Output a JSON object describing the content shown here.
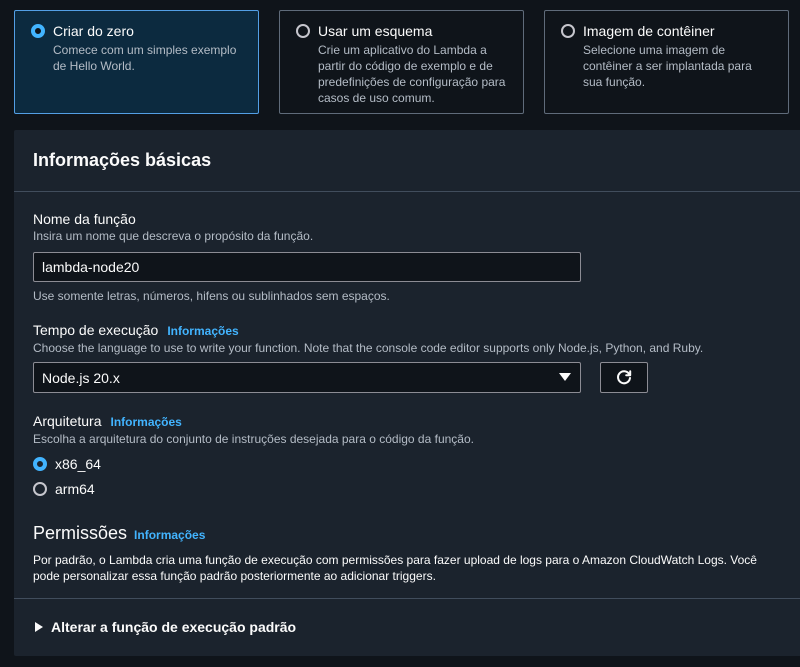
{
  "options": [
    {
      "title": "Criar do zero",
      "description": "Comece com um simples exemplo de Hello World.",
      "selected": true
    },
    {
      "title": "Usar um esquema",
      "description": "Crie um aplicativo do Lambda a partir do código de exemplo e de predefinições de configuração para casos de uso comum.",
      "selected": false
    },
    {
      "title": "Imagem de contêiner",
      "description": "Selecione uma imagem de contêiner a ser implantada para sua função.",
      "selected": false
    }
  ],
  "basic_info": {
    "title": "Informações básicas",
    "function_name": {
      "label": "Nome da função",
      "description": "Insira um nome que descreva o propósito da função.",
      "value": "lambda-node20",
      "constraint": "Use somente letras, números, hifens ou sublinhados sem espaços."
    },
    "runtime": {
      "label": "Tempo de execução",
      "info": "Informações",
      "description": "Choose the language to use to write your function. Note that the console code editor supports only Node.js, Python, and Ruby.",
      "selected": "Node.js 20.x",
      "refresh_icon": "refresh-icon"
    },
    "architecture": {
      "label": "Arquitetura",
      "info": "Informações",
      "description": "Escolha a arquitetura do conjunto de instruções desejada para o código da função.",
      "options": [
        {
          "label": "x86_64",
          "selected": true
        },
        {
          "label": "arm64",
          "selected": false
        }
      ]
    },
    "permissions": {
      "title": "Permissões",
      "info": "Informações",
      "text": "Por padrão, o Lambda cria uma função de execução com permissões para fazer upload de logs para o Amazon CloudWatch Logs. Você pode personalizar essa função padrão posteriormente ao adicionar triggers."
    },
    "expander_label": "Alterar a função de execução padrão"
  },
  "colors": {
    "accent": "#42b4ff",
    "background": "#0f141a",
    "panel": "#1b232d"
  }
}
